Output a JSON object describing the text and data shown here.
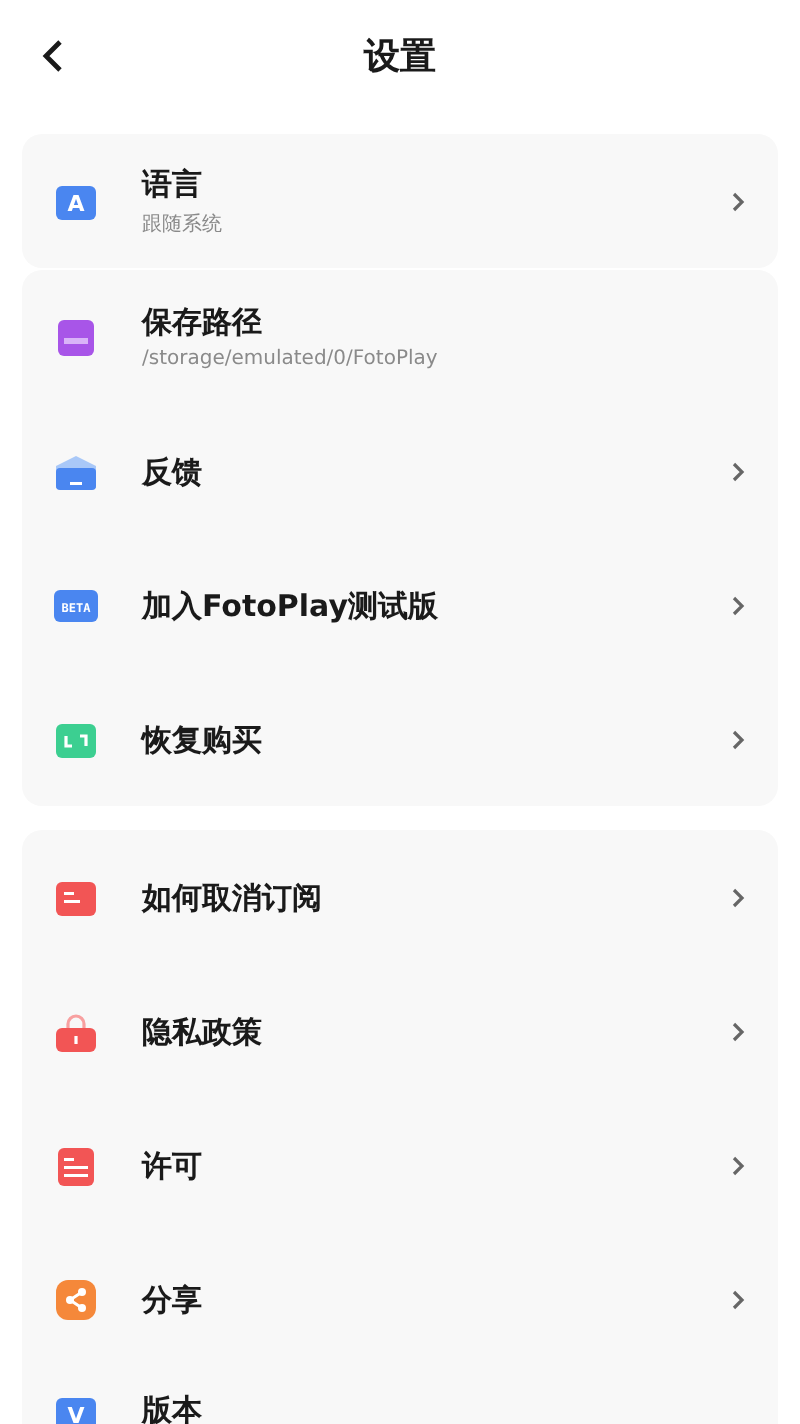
{
  "header": {
    "title": "设置"
  },
  "groups": [
    {
      "items": [
        {
          "kind": "language",
          "color": "#4a86f0",
          "icon_text": "A",
          "title": "语言",
          "subtitle": "跟随系统",
          "arrow": true
        }
      ]
    },
    {
      "items": [
        {
          "kind": "folder",
          "color": "#a855e8",
          "title": "保存路径",
          "subtitle": "/storage/emulated/0/FotoPlay",
          "arrow": false
        },
        {
          "kind": "mail",
          "color": "#4a86f0",
          "title": "反馈",
          "arrow": true
        },
        {
          "kind": "beta",
          "color": "#4a86f0",
          "icon_text": "BETA",
          "title": "加入FotoPlay测试版",
          "arrow": true
        },
        {
          "kind": "restore",
          "color": "#3ccf91",
          "title": "恢复购买",
          "arrow": true
        }
      ]
    },
    {
      "items": [
        {
          "kind": "list",
          "color": "#f25555",
          "title": "如何取消订阅",
          "arrow": true
        },
        {
          "kind": "lock",
          "color": "#f25555",
          "title": "隐私政策",
          "arrow": true
        },
        {
          "kind": "license",
          "color": "#f25555",
          "title": "许可",
          "arrow": true
        },
        {
          "kind": "share",
          "color": "#f5883a",
          "title": "分享",
          "arrow": true
        },
        {
          "kind": "version",
          "color": "#4a86f0",
          "icon_text": "V",
          "title": "版本",
          "arrow": false
        }
      ]
    }
  ]
}
